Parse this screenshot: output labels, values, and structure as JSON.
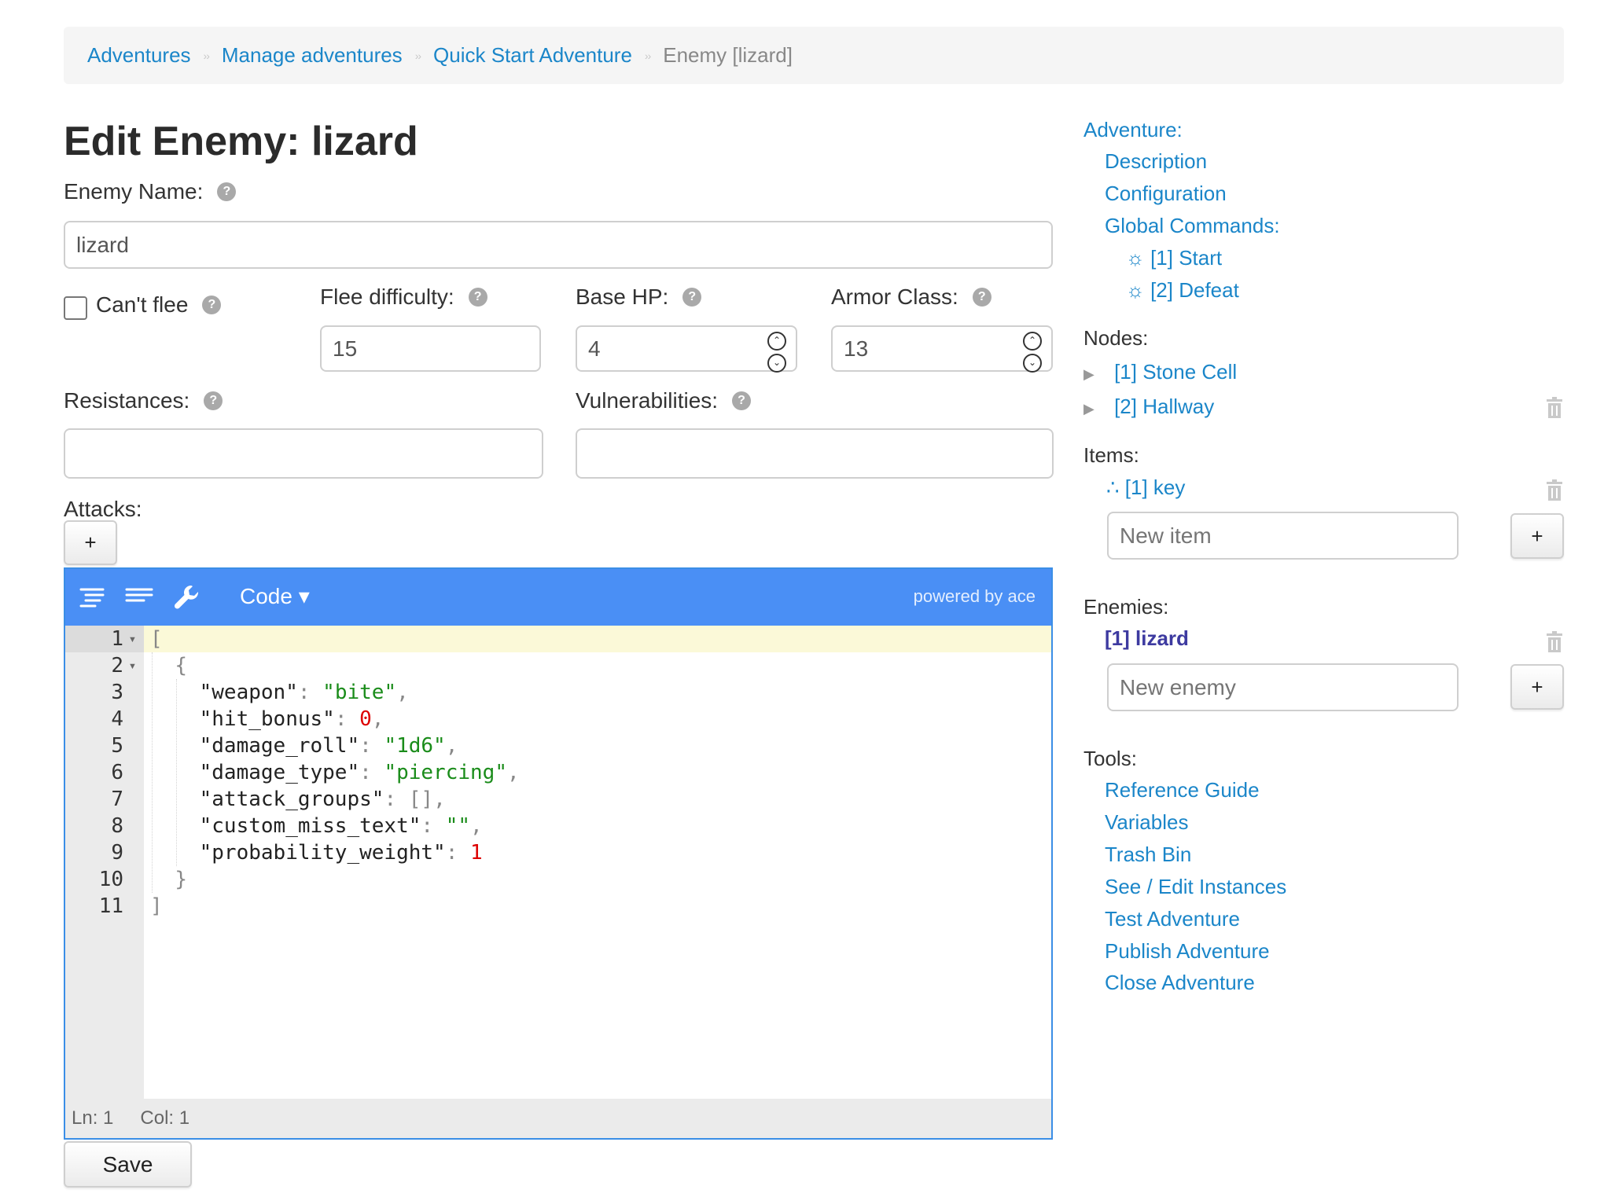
{
  "breadcrumb": {
    "items": [
      "Adventures",
      "Manage adventures",
      "Quick Start Adventure"
    ],
    "current": "Enemy [lizard]",
    "separator": "››"
  },
  "page": {
    "title": "Edit Enemy: lizard"
  },
  "form": {
    "enemy_name_label": "Enemy Name:",
    "enemy_name_value": "lizard",
    "cant_flee_label": "Can't flee",
    "cant_flee_checked": false,
    "flee_difficulty_label": "Flee difficulty:",
    "flee_difficulty_value": "15",
    "base_hp_label": "Base HP:",
    "base_hp_value": "4",
    "armor_class_label": "Armor Class:",
    "armor_class_value": "13",
    "resistances_label": "Resistances:",
    "resistances_value": "",
    "vulnerabilities_label": "Vulnerabilities:",
    "vulnerabilities_value": "",
    "attacks_label": "Attacks:",
    "add_attack_label": "+",
    "save_label": "Save",
    "help_glyph": "?"
  },
  "editor": {
    "mode_label": "Code ▾",
    "powered_label": "powered by ace",
    "status_ln": "Ln: 1",
    "status_col": "Col: 1",
    "line_numbers": [
      "1",
      "2",
      "3",
      "4",
      "5",
      "6",
      "7",
      "8",
      "9",
      "10",
      "11"
    ],
    "lines": [
      "[",
      "  {",
      "    \"weapon\": \"bite\",",
      "    \"hit_bonus\": 0,",
      "    \"damage_roll\": \"1d6\",",
      "    \"damage_type\": \"piercing\",",
      "    \"attack_groups\": [],",
      "    \"custom_miss_text\": \"\",",
      "    \"probability_weight\": 1",
      "  }",
      "]"
    ]
  },
  "sidebar": {
    "adventure_label": "Adventure:",
    "description": "Description",
    "configuration": "Configuration",
    "global_commands_label": "Global Commands:",
    "global_commands": [
      "[1] Start",
      "[2] Defeat"
    ],
    "nodes_label": "Nodes:",
    "nodes": [
      "[1] Stone Cell",
      "[2] Hallway"
    ],
    "items_label": "Items:",
    "items": [
      "[1] key"
    ],
    "new_item_placeholder": "New item",
    "add_item_label": "+",
    "enemies_label": "Enemies:",
    "enemies": [
      "[1] lizard"
    ],
    "new_enemy_placeholder": "New enemy",
    "add_enemy_label": "+",
    "tools_label": "Tools:",
    "tools": [
      "Reference Guide",
      "Variables",
      "Trash Bin",
      "See / Edit Instances",
      "Test Adventure",
      "Publish Adventure",
      "Close Adventure"
    ]
  },
  "colors": {
    "link": "#1b86c9",
    "editor_toolbar": "#4a8ff5",
    "active_enemy": "#3d3aa0"
  }
}
